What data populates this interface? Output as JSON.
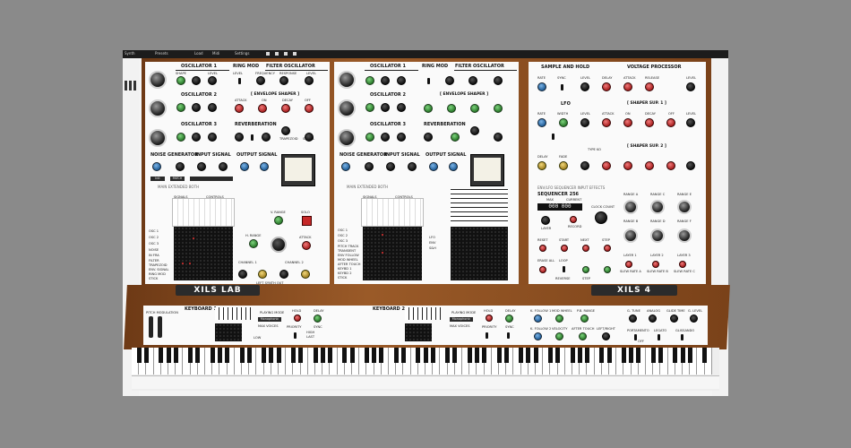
{
  "app": {
    "topbar_items": [
      "Synth",
      "Presets",
      "Load",
      "Midi",
      "Settings"
    ]
  },
  "logos": {
    "left": "XILS LAB",
    "right": "XILS 4"
  },
  "panels": {
    "left": {
      "osc1": "OSCILLATOR 1",
      "osc2": "OSCILLATOR 2",
      "osc3": "OSCILLATOR 3",
      "ringmod": "RING MOD",
      "filter": "FILTER OSCILLATOR",
      "env": "[ ENVELOPE SHAPER ]",
      "reverb": "REVERBERATION",
      "noise": "NOISE GENERATOR",
      "input": "INPUT SIGNAL",
      "output": "OUTPUT SIGNAL",
      "tabs": "MAIN   EXTENDED   BOTH",
      "labels": {
        "shape": "SHAPE",
        "level": "LEVEL",
        "freq": "FREQUENCY",
        "response": "RESPONSE",
        "attack": "ATTACK",
        "on": "ON",
        "decay": "DECAY",
        "off": "OFF",
        "trapezoid": "TRAPEZOID",
        "signal": "SIGNAL",
        "colour": "COLOR",
        "channel1": "CHANNEL 1",
        "channel2": "CHANNEL 2",
        "vrange": "V. RANGE",
        "hrange": "H. RANGE",
        "solo": "SOLO",
        "sync": "SYNC",
        "pan": "PAN",
        "leftsynth": "LEFT SYNTH OUT",
        "signals": "SIGNALS",
        "controls": "CONTROLS"
      },
      "source_list": [
        "OSC 1",
        "OSC 2",
        "OSC 3",
        "NOISE",
        "IN FRA",
        "FILTER",
        "TRAPEZOID",
        "ENV. SIGNAL",
        "RING MOD",
        "REVERB",
        "STICK"
      ],
      "patch": "PATCH",
      "init": "Init"
    },
    "middle": {
      "osc1": "OSCILLATOR 1",
      "osc2": "OSCILLATOR 2",
      "osc3": "OSCILLATOR 3",
      "ringmod": "RING MOD",
      "filter": "FILTER OSCILLATOR",
      "env": "[ ENVELOPE SHAPER ]",
      "reverb": "REVERBERATION",
      "noise": "NOISE GENERATOR",
      "input": "INPUT SIGNAL",
      "output": "OUTPUT SIGNAL",
      "tabs": "MAIN   EXTENDED   BOTH",
      "source_list": [
        "OSC 1",
        "OSC 2",
        "OSC 3",
        "PITCH TRACK",
        "TRANSIENT",
        "ENV FOLLOW",
        "MOD WHEEL",
        "AFTER TOUCH",
        "KEYBD 1",
        "KEYBD 2",
        "LFO",
        "ENV",
        "S&H",
        "STICK"
      ],
      "signals": "SIGNALS",
      "controls": "CONTROLS"
    },
    "right": {
      "sh": "SAMPLE AND HOLD",
      "vp": "VOLTAGE PROCESSOR",
      "lfo": "LFO",
      "shaper1": "[ SHAPER SUP. 1 ]",
      "shaper2": "[ SHAPER SUP. 2 ]",
      "tabs": "ENV/LFO   SEQUENCER   INPUT   EFFECTS",
      "sequencer": "SEQUENCER 256",
      "lcd": "000 000",
      "labels": {
        "rate": "RATE",
        "sync": "SYNC",
        "level": "LEVEL",
        "delay": "DELAY",
        "attack": "ATTACK",
        "release": "RELEASE",
        "width": "WIDTH",
        "on": "ON",
        "decay": "DECAY",
        "off": "OFF",
        "fade": "FADE",
        "max": "MAX",
        "current": "CURRENT",
        "clock": "CLOCK COUNT",
        "layer": "LAYER",
        "record": "RECORD",
        "reset": "RESET",
        "start": "START",
        "next": "NEXT",
        "step": "STEP",
        "erase": "ERASE ALL",
        "loop": "LOOP",
        "reverse": "REVERSE",
        "rangeA": "RANGE A",
        "rangeB": "RANGE B",
        "rangeC": "RANGE C",
        "rangeD": "RANGE D",
        "rangeE": "RANGE E",
        "rangeF": "RANGE F",
        "layer1": "LAYER 1",
        "layer2": "LAYER 2",
        "layer3": "LAYER 3",
        "slewA": "SLEW RATE A",
        "slewB": "SLEW RATE B",
        "slewC": "SLEW RATE C",
        "typeko": "TYPE KO"
      }
    }
  },
  "keyboard_panel": {
    "pitchmod": "PITCH MODULATION",
    "kb1": "KEYBOARD 1",
    "kb2": "KEYBOARD 2",
    "playing_mode": "PLAYING MODE",
    "mode_value": "Monophonic",
    "hold": "HOLD",
    "delay": "DELAY",
    "sync": "SYNC",
    "priority": "PRIORITY",
    "high": "HIGH",
    "last": "LAST",
    "low": "LOW",
    "max_voices": "MAX VOICES",
    "follow1": "K. FOLLOW 1",
    "modwheel": "MOD WHEEL",
    "pbrange": "P.B. RANGE",
    "follow2": "K. FOLLOW 2",
    "velocity": "VELOCITY",
    "aftertouch": "AFTER TOUCH",
    "leftright": "LEFT/RIGHT",
    "tune": "G. TUNE",
    "analog": "ANALOG",
    "glide": "GLIDE TIME",
    "glevel": "G. LEVEL",
    "portamento": "PORTAMENTO",
    "legato": "LEGATO",
    "glissando": "GLISSANDO",
    "on": "ON",
    "off": "OFF"
  }
}
